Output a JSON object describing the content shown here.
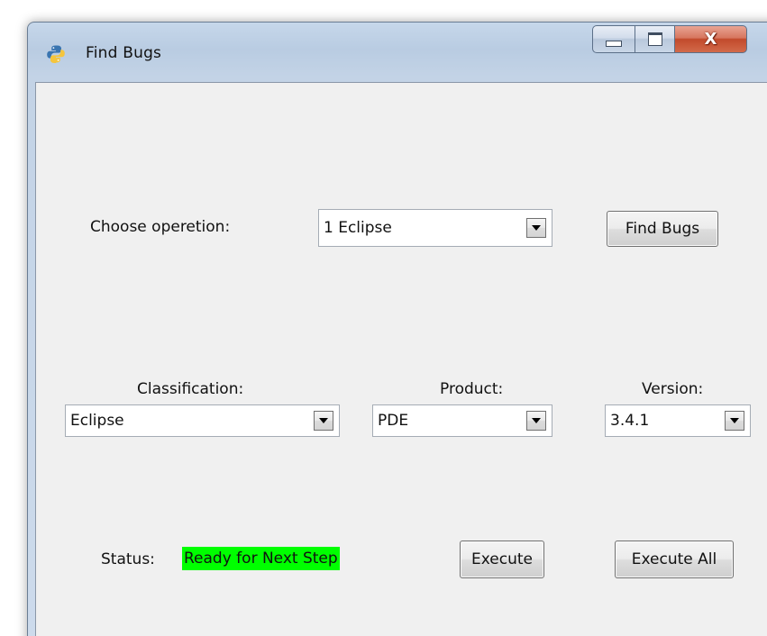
{
  "window": {
    "title": "Find Bugs",
    "icon": "python-icon",
    "close_glyph": "X"
  },
  "operation": {
    "label": "Choose operetion:",
    "selected": "1 Eclipse",
    "find_button": "Find Bugs"
  },
  "classification": {
    "label": "Classification:",
    "selected": "Eclipse"
  },
  "product": {
    "label": "Product:",
    "selected": "PDE"
  },
  "version": {
    "label": "Version:",
    "selected": "3.4.1"
  },
  "status": {
    "label": "Status:",
    "value": "Ready for Next Step",
    "color": "#00ff00"
  },
  "actions": {
    "execute": "Execute",
    "execute_all": "Execute All"
  }
}
